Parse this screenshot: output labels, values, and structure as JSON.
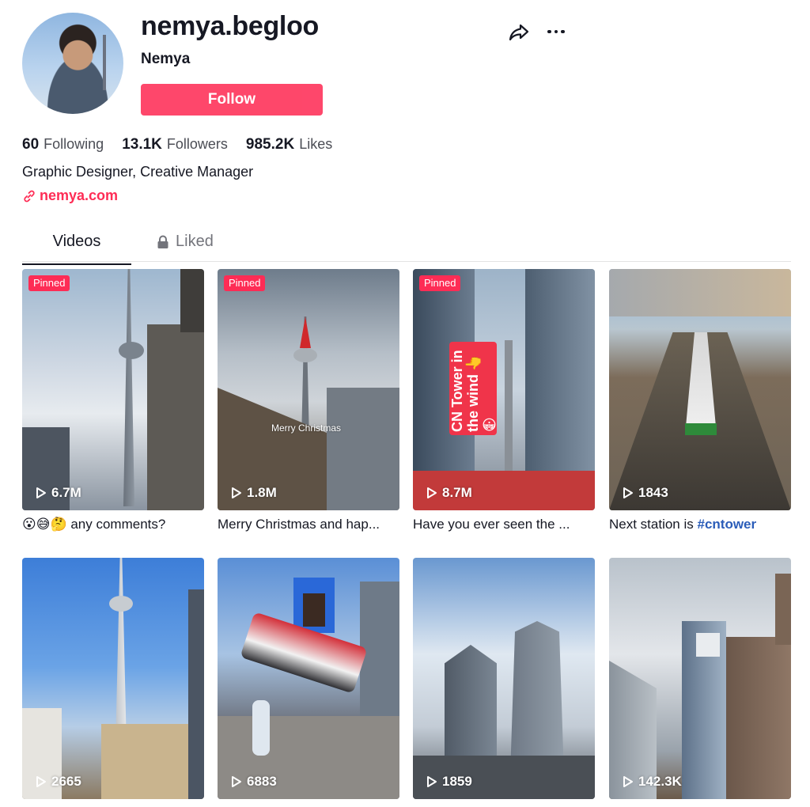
{
  "profile": {
    "username": "nemya.begloo",
    "nickname": "Nemya",
    "follow_label": "Follow",
    "bio": "Graphic Designer, Creative Manager",
    "link": "nemya.com"
  },
  "stats": [
    {
      "value": "60",
      "label": "Following"
    },
    {
      "value": "13.1K",
      "label": "Followers"
    },
    {
      "value": "985.2K",
      "label": "Likes"
    }
  ],
  "tabs": {
    "videos": "Videos",
    "liked": "Liked"
  },
  "videos": [
    {
      "pinned": "Pinned",
      "views": "6.7M",
      "caption": "😮😅🤔 any comments?"
    },
    {
      "pinned": "Pinned",
      "views": "1.8M",
      "caption": "Merry Christmas and hap...",
      "overlay": "Merry Christmas"
    },
    {
      "pinned": "Pinned",
      "views": "8.7M",
      "caption": "Have you ever seen the ...",
      "sticker": "CN Tower in the wind 👉😳"
    },
    {
      "views": "1843",
      "caption_text": "Next station is ",
      "caption_tag": "#cntower"
    },
    {
      "views": "2665"
    },
    {
      "views": "6883"
    },
    {
      "views": "1859"
    },
    {
      "views": "142.3K"
    }
  ],
  "icons": {
    "share": "share-icon",
    "more": "more-icon",
    "link": "link-icon",
    "lock": "lock-icon",
    "play": "play-icon"
  },
  "colors": {
    "accent": "#fe2c55",
    "hashtag": "#2b5db9"
  }
}
